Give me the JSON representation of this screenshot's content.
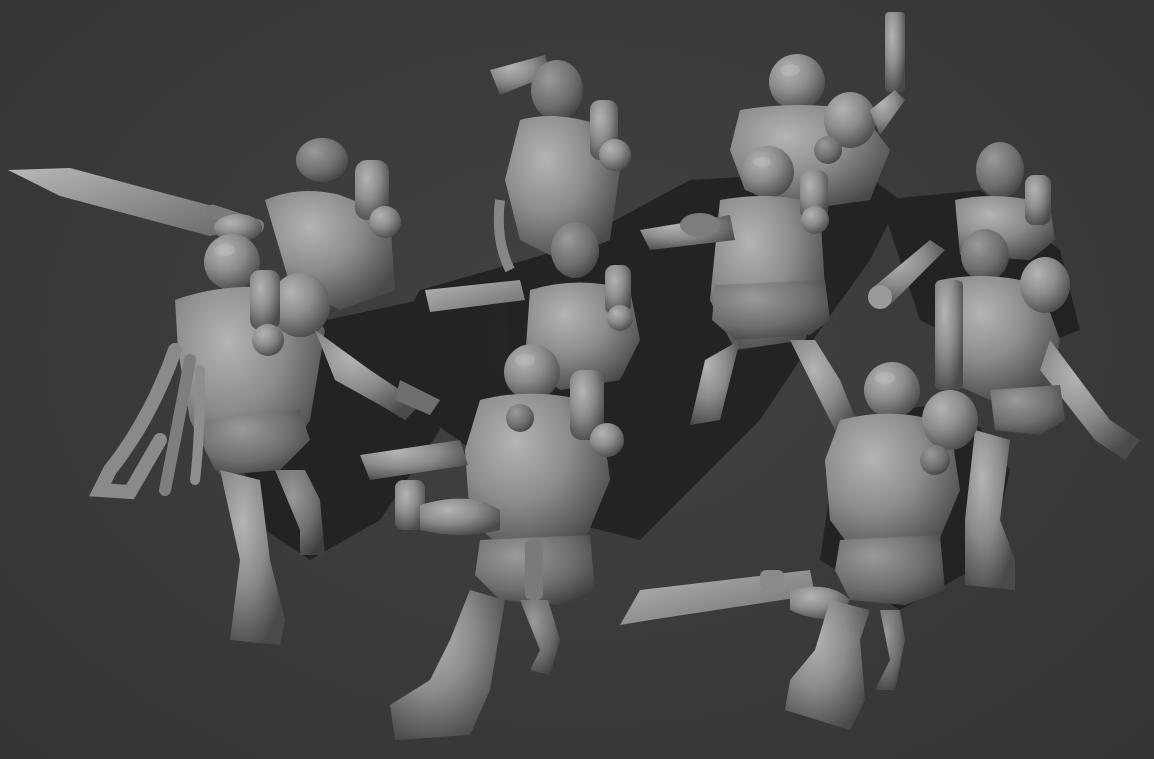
{
  "scene": {
    "background_color": "#3b3b3b",
    "model_color": "#8f8f8f",
    "shadow_color": "#1c1c1c",
    "figure_count": 10
  }
}
